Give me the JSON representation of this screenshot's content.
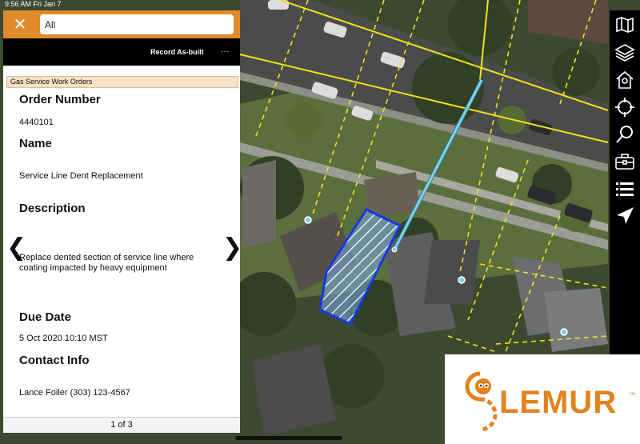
{
  "status_bar": {
    "time": "9:56 AM  Fri Jan 7"
  },
  "panel": {
    "search_value": "All",
    "toolbar": {
      "record_label": "Record As-built",
      "more_label": "..."
    },
    "layer_label": "Gas Service Work Orders",
    "fields": [
      {
        "title": "Order Number",
        "value": "4440101"
      },
      {
        "title": "Name",
        "value": "Service Line Dent Replacement"
      },
      {
        "title": "Description",
        "value": "Replace dented section of service line where coating impacted by heavy equipment"
      },
      {
        "title": "Due Date",
        "value": "5 Oct 2020 10:10 MST"
      },
      {
        "title": "Contact Info",
        "value": "Lance Foiler (303) 123-4567"
      }
    ],
    "pager": "1 of 3",
    "prev_glyph": "❮",
    "next_glyph": "❯"
  },
  "toolbar_icons": [
    "map-icon",
    "layers-icon",
    "home-location-icon",
    "crosshair-icon",
    "search-icon",
    "toolbox-icon",
    "list-icon",
    "navigate-icon"
  ],
  "logo": {
    "name": "LEMUR",
    "trademark": "™"
  },
  "colors": {
    "panel_header": "#e08a2c",
    "parcel_line": "#f3e21a",
    "service_line": "#7fd3ec",
    "work_area": "#1638e0",
    "logo": "#e3821e"
  }
}
